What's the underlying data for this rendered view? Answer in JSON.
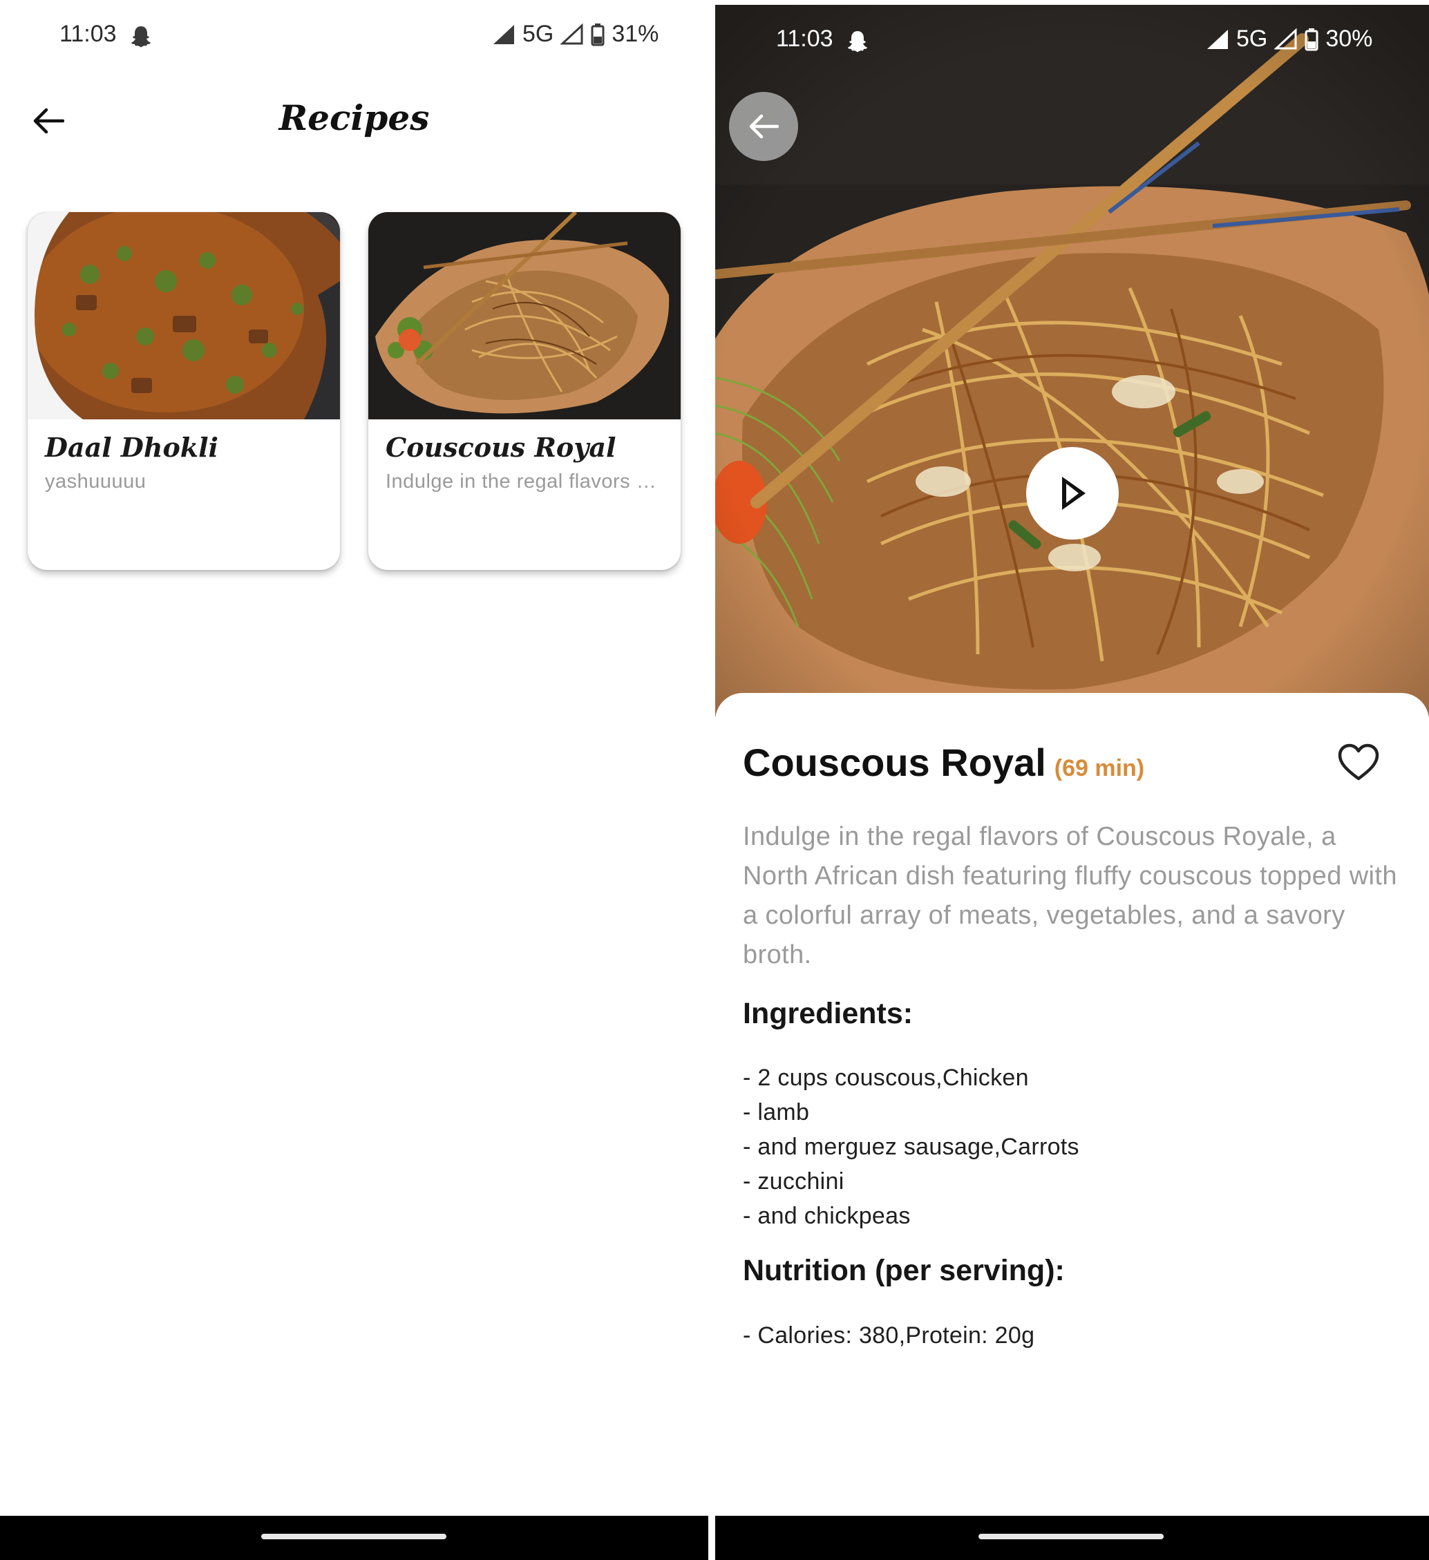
{
  "left_screen": {
    "status": {
      "time": "11:03",
      "network": "5G",
      "battery": "31%"
    },
    "app_bar": {
      "title": "Recipes"
    },
    "cards": [
      {
        "title": "Daal Dhokli",
        "subtitle": "yashuuuuu",
        "image": "daal-dhokli-photo"
      },
      {
        "title": "Couscous Royal",
        "subtitle": "Indulge in the regal flavors of Couscous Royale, a North African dish featuring fluffy couscous topped with a colorful array of meats, vegetables, and a savory broth.",
        "image": "couscous-royal-photo"
      }
    ]
  },
  "right_screen": {
    "status": {
      "time": "11:03",
      "network": "5G",
      "battery": "30%"
    },
    "recipe": {
      "title": "Couscous Royal",
      "time": "(69 min)",
      "description": "Indulge in the regal flavors of Couscous Royale, a North African dish featuring fluffy couscous topped with a colorful array of meats, vegetables, and a savory broth.",
      "ingredients_heading": "Ingredients:",
      "ingredients": [
        "- 2 cups couscous,Chicken",
        "- lamb",
        "- and merguez sausage,Carrots",
        "- zucchini",
        "- and chickpeas"
      ],
      "nutrition_heading": "Nutrition (per serving):",
      "nutrition": [
        "- Calories: 380,Protein: 20g"
      ]
    }
  },
  "colors": {
    "accent_time": "#d98b3a",
    "muted_text": "#9a9a9a",
    "nav_bar": "#000000"
  },
  "icons": [
    "back-arrow-icon",
    "snapchat-ghost-icon",
    "signal-icon",
    "battery-icon",
    "play-icon",
    "heart-outline-icon"
  ]
}
